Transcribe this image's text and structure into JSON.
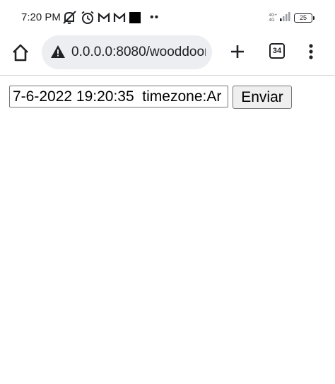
{
  "status_bar": {
    "time": "7:20 PM",
    "network_label": "4G+",
    "network_label_2": "4G",
    "battery_level": "25",
    "icons": [
      "mute-icon",
      "alarm-icon",
      "gmail-icon",
      "gmail-icon",
      "notification-square-icon",
      "more-dots-icon",
      "signal-icon",
      "battery-icon"
    ],
    "dots": "••"
  },
  "browser": {
    "url": "0.0.0.0:8080/wooddoor",
    "tab_count": "34",
    "icons": [
      "home-icon",
      "not-secure-warning-icon",
      "new-tab-plus-icon",
      "tabs-icon",
      "more-vertical-icon"
    ]
  },
  "form": {
    "input_value": "7-6-2022 19:20:35  timezone:Ar",
    "submit_label": "Enviar"
  }
}
